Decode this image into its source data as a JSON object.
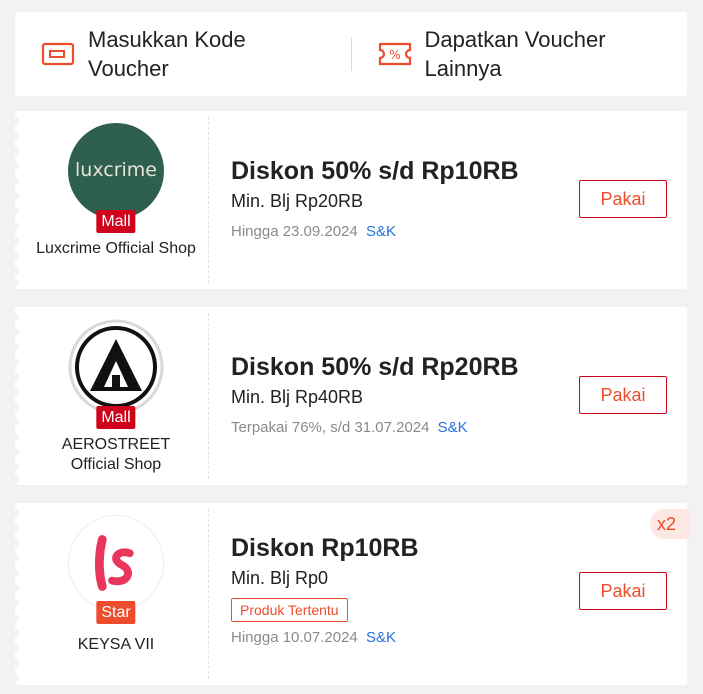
{
  "actions": {
    "enter_code": "Masukkan Kode Voucher",
    "get_more": "Dapatkan Voucher Lainnya"
  },
  "vouchers": [
    {
      "shop_logo_text": "luxcrime",
      "badge": "Mall",
      "shop_name": "Luxcrime Official Shop",
      "title": "Diskon 50% s/d Rp10RB",
      "min_spend": "Min. Blj Rp20RB",
      "validity": "Hingga 23.09.2024",
      "terms": "S&K",
      "button": "Pakai"
    },
    {
      "badge": "Mall",
      "shop_name": "AEROSTREET Official Shop",
      "title": "Diskon 50% s/d Rp20RB",
      "min_spend": "Min. Blj Rp40RB",
      "validity": "Terpakai 76%, s/d 31.07.2024",
      "usage_fraction": 0.76,
      "terms": "S&K",
      "button": "Pakai"
    },
    {
      "badge": "Star",
      "shop_name": "KEYSA VII",
      "title": "Diskon Rp10RB",
      "min_spend": "Min. Blj Rp0",
      "tag": "Produk Tertentu",
      "validity": "Hingga 10.07.2024",
      "terms": "S&K",
      "button": "Pakai",
      "quantity": "x2"
    }
  ],
  "colors": {
    "accent": "#ee4d2d",
    "mall_red": "#d0011b",
    "link_blue": "#2673dd",
    "luxcrime_green": "#2e5f4f"
  },
  "icons": {
    "enter_code": "voucher-code-icon",
    "get_more": "percent-ticket-icon"
  }
}
